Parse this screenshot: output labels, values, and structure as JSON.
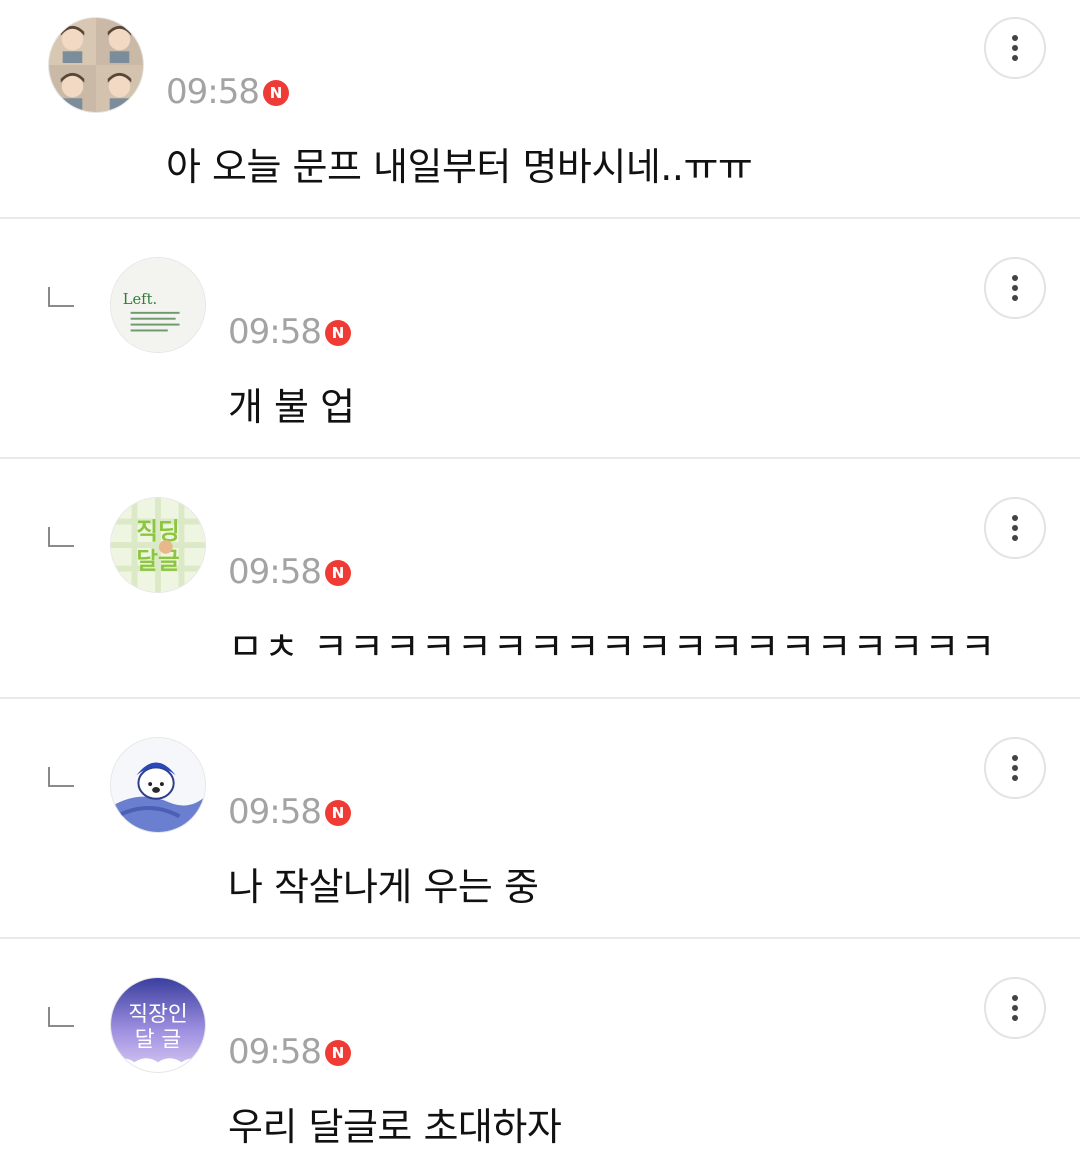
{
  "comments": [
    {
      "time": "09:58",
      "badge": "N",
      "text": "아 오늘 문프 내일부터 명바시네..ㅠㅠ",
      "avatar": "avatar-photo-grid-icon"
    },
    {
      "time": "09:58",
      "badge": "N",
      "text": "개 불 업",
      "avatar": "avatar-left-logo-icon",
      "avatar_text": "Left."
    },
    {
      "time": "09:58",
      "badge": "N",
      "text": "ㅁㅊ ㅋㅋㅋㅋㅋㅋㅋㅋㅋㅋㅋㅋㅋㅋㅋㅋㅋㅋㅋ",
      "avatar": "avatar-dalgeul-icon",
      "avatar_text": [
        "직딩",
        "달글"
      ]
    },
    {
      "time": "09:58",
      "badge": "N",
      "text": "나 작살나게 우는 중",
      "avatar": "avatar-blue-character-icon"
    },
    {
      "time": "09:58",
      "badge": "N",
      "text": "우리 달글로 초대하자",
      "avatar": "avatar-jikjangin-icon",
      "avatar_text": [
        "직장인",
        "달 글"
      ]
    }
  ],
  "colors": {
    "badge": "#ef3b36",
    "time": "#a3a3a3",
    "divider": "#e9e9e9"
  }
}
